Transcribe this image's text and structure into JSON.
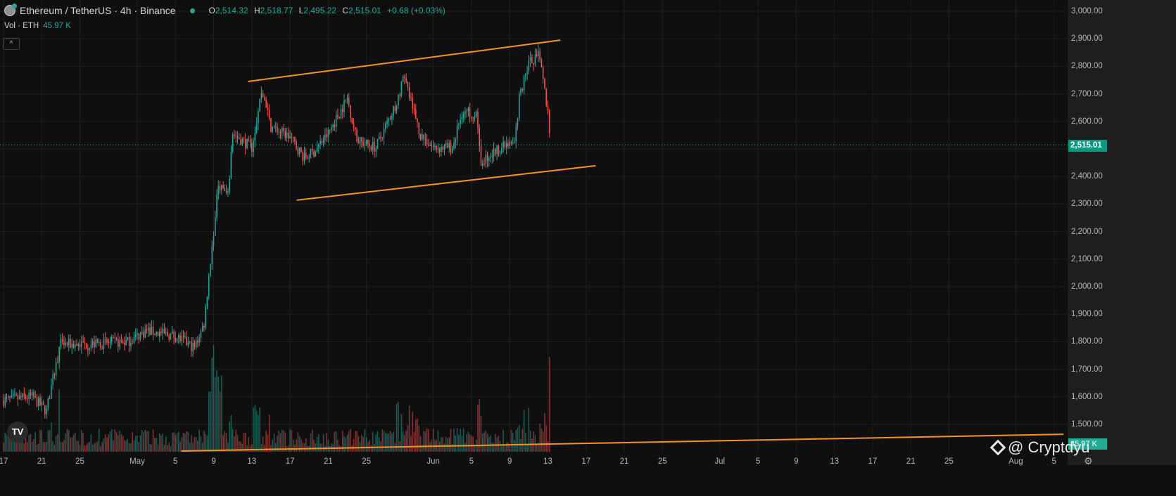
{
  "header": {
    "symbol": "Ethereum / TetherUS · 4h · Binance",
    "o_label": "O",
    "o": "2,514.32",
    "h_label": "H",
    "h": "2,518.77",
    "l_label": "L",
    "l": "2,495.22",
    "c_label": "C",
    "c": "2,515.01",
    "change": "+0.68 (+0.03%)"
  },
  "volume": {
    "label": "Vol · ETH",
    "value": "45.97 K"
  },
  "last_price": "2,515.01",
  "last_volume": "45.97 K",
  "watermark": "@ Cryptdyu",
  "logo": "TV",
  "colors": {
    "up": "#26a69a",
    "down": "#ef5350",
    "trend": "#f7931a",
    "bg": "#0f0f0f"
  },
  "price_axis": {
    "min": 1450,
    "max": 3040,
    "ticks": [
      "3,000.00",
      "2,900.00",
      "2,800.00",
      "2,700.00",
      "2,600.00",
      "2,500.00",
      "2,400.00",
      "2,300.00",
      "2,200.00",
      "2,100.00",
      "2,000.00",
      "1,900.00",
      "1,800.00",
      "1,700.00",
      "1,600.00",
      "1,500.00"
    ],
    "tick_values": [
      3000,
      2900,
      2800,
      2700,
      2600,
      2500,
      2400,
      2300,
      2200,
      2100,
      2000,
      1900,
      1800,
      1700,
      1600,
      1500
    ]
  },
  "time_axis": [
    {
      "t": "17",
      "d": 0
    },
    {
      "t": "21",
      "d": 4
    },
    {
      "t": "25",
      "d": 8
    },
    {
      "t": "May",
      "d": 14
    },
    {
      "t": "5",
      "d": 18
    },
    {
      "t": "9",
      "d": 22
    },
    {
      "t": "13",
      "d": 26
    },
    {
      "t": "17",
      "d": 30
    },
    {
      "t": "21",
      "d": 34
    },
    {
      "t": "25",
      "d": 38
    },
    {
      "t": "Jun",
      "d": 45
    },
    {
      "t": "5",
      "d": 49
    },
    {
      "t": "9",
      "d": 53
    },
    {
      "t": "13",
      "d": 57
    },
    {
      "t": "17",
      "d": 61
    },
    {
      "t": "21",
      "d": 65
    },
    {
      "t": "25",
      "d": 69
    },
    {
      "t": "Jul",
      "d": 75
    },
    {
      "t": "5",
      "d": 79
    },
    {
      "t": "9",
      "d": 83
    },
    {
      "t": "13",
      "d": 87
    },
    {
      "t": "17",
      "d": 91
    },
    {
      "t": "21",
      "d": 95
    },
    {
      "t": "25",
      "d": 99
    },
    {
      "t": "Aug",
      "d": 106
    },
    {
      "t": "5",
      "d": 110
    }
  ],
  "price_path": [
    [
      0,
      1587
    ],
    [
      3,
      1600
    ],
    [
      4.5,
      1548
    ],
    [
      5,
      1638
    ],
    [
      6,
      1791
    ],
    [
      9,
      1790
    ],
    [
      13,
      1800
    ],
    [
      15,
      1840
    ],
    [
      18,
      1820
    ],
    [
      20,
      1778
    ],
    [
      21,
      1867
    ],
    [
      22,
      2200
    ],
    [
      22.5,
      2378
    ],
    [
      23.5,
      2327
    ],
    [
      24,
      2556
    ],
    [
      26,
      2505
    ],
    [
      27,
      2709
    ],
    [
      28,
      2582
    ],
    [
      30,
      2543
    ],
    [
      31.5,
      2467
    ],
    [
      32.5,
      2490
    ],
    [
      34,
      2556
    ],
    [
      36,
      2684
    ],
    [
      37,
      2530
    ],
    [
      39,
      2505
    ],
    [
      41,
      2658
    ],
    [
      42,
      2760
    ],
    [
      43.5,
      2556
    ],
    [
      45,
      2505
    ],
    [
      47,
      2505
    ],
    [
      48,
      2633
    ],
    [
      49.5,
      2633
    ],
    [
      50,
      2454
    ],
    [
      52,
      2505
    ],
    [
      53.5,
      2518
    ],
    [
      54,
      2684
    ],
    [
      55,
      2811
    ],
    [
      56,
      2837
    ],
    [
      56.5,
      2747
    ],
    [
      57,
      2633
    ],
    [
      57.3,
      2515
    ]
  ],
  "trendlines": [
    {
      "name": "channel-upper",
      "p1": [
        25.6,
        2745
      ],
      "p2": [
        58.3,
        2895
      ]
    },
    {
      "name": "channel-lower",
      "p1": [
        30.7,
        2314
      ],
      "p2": [
        62,
        2439
      ]
    },
    {
      "name": "long-support",
      "p1": [
        18.6,
        1403
      ],
      "p2": [
        111,
        1464
      ]
    }
  ]
}
